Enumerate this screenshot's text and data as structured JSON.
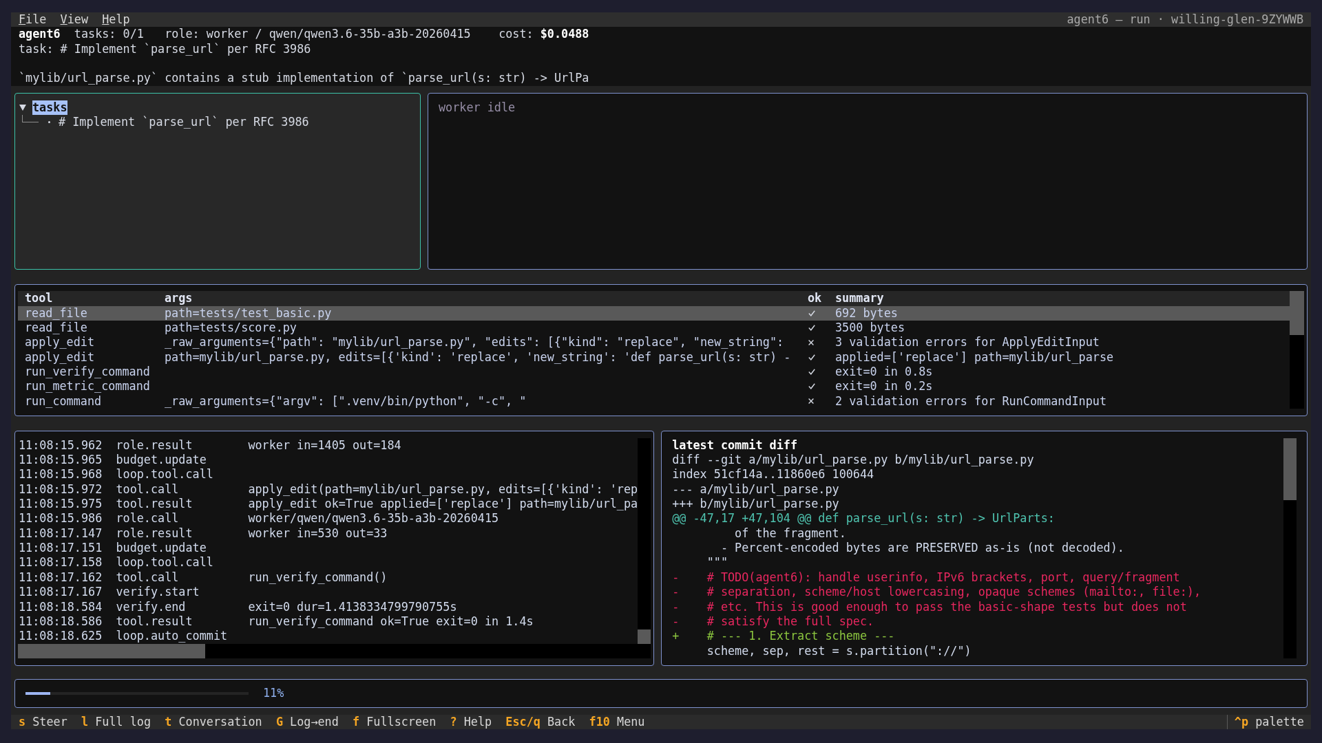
{
  "menu_bar": {
    "items": [
      {
        "label": "File"
      },
      {
        "label": "View"
      },
      {
        "label": "Help"
      }
    ],
    "title": "agent6 — run · willing-glen-9ZYWWB"
  },
  "header": {
    "app_name": "agent6",
    "tasks": "tasks: 0/1",
    "role": "role: worker / qwen/qwen3.6-35b-a3b-20260415",
    "cost": "cost: **$0.0488**",
    "task": "task: # Implement `parse_url` per RFC 3986",
    "description": "`mylib/url_parse.py` contains a stub implementation of `parse_url(s: str) -> UrlPa"
  },
  "task_tree": {
    "label": "tasks",
    "expanded": true,
    "selected": true,
    "children": [
      {
        "label": "# Implement `parse_url` per RFC 3986",
        "selected": false
      }
    ]
  },
  "worker_panel": {
    "status": "worker idle"
  },
  "tool_calls": {
    "columns": [
      "tool",
      "args",
      "ok",
      "summary"
    ],
    "rows": [
      {
        "tool": "read_file",
        "args": "path=tests/test_basic.py",
        "ok": true,
        "summary": "692 bytes",
        "selected": true
      },
      {
        "tool": "read_file",
        "args": "path=tests/score.py",
        "ok": true,
        "summary": "3500 bytes",
        "selected": false
      },
      {
        "tool": "apply_edit",
        "args": "_raw_arguments={\"path\": \"mylib/url_parse.py\", \"edits\": [{\"kind\": \"replace\", \"new_string\":",
        "ok": false,
        "summary": "3 validation errors for ApplyEditInput",
        "selected": false
      },
      {
        "tool": "apply_edit",
        "args": "path=mylib/url_parse.py, edits=[{'kind': 'replace', 'new_string': 'def parse_url(s: str) -",
        "ok": true,
        "summary": "applied=['replace'] path=mylib/url_parse",
        "selected": false
      },
      {
        "tool": "run_verify_command",
        "ok": true,
        "summary": "exit=0 in 0.8s",
        "selected": false
      },
      {
        "tool": "run_metric_command",
        "ok": true,
        "summary": "exit=0 in 0.2s",
        "selected": false
      },
      {
        "tool": "run_command",
        "args": "_raw_arguments={\"argv\": [\".venv/bin/python\", \"-c\", \"",
        "ok": false,
        "summary": "2 validation errors for RunCommandInput",
        "selected": false
      }
    ]
  },
  "event_log": {
    "rows": [
      {
        "time": "11:08:15.962",
        "event": "role.result",
        "detail": "worker in=1405 out=184"
      },
      {
        "time": "11:08:15.965",
        "event": "budget.update"
      },
      {
        "time": "11:08:15.968",
        "event": "loop.tool.call"
      },
      {
        "time": "11:08:15.972",
        "event": "tool.call",
        "detail": "apply_edit(path=mylib/url_parse.py, edits=[{'kind': 'rep"
      },
      {
        "time": "11:08:15.975",
        "event": "tool.result",
        "detail": "apply_edit ok=True applied=['replace'] path=mylib/url_pa"
      },
      {
        "time": "11:08:15.986",
        "event": "role.call",
        "detail": "worker/qwen/qwen3.6-35b-a3b-20260415"
      },
      {
        "time": "11:08:17.147",
        "event": "role.result",
        "detail": "worker in=530 out=33"
      },
      {
        "time": "11:08:17.151",
        "event": "budget.update"
      },
      {
        "time": "11:08:17.158",
        "event": "loop.tool.call"
      },
      {
        "time": "11:08:17.162",
        "event": "tool.call",
        "detail": "run_verify_command()"
      },
      {
        "time": "11:08:17.167",
        "event": "verify.start"
      },
      {
        "time": "11:08:18.584",
        "event": "verify.end",
        "detail": "exit=0 dur=1.4138334799790755s"
      },
      {
        "time": "11:08:18.586",
        "event": "tool.result",
        "detail": "run_verify_command ok=True exit=0 in 1.4s"
      },
      {
        "time": "11:08:18.625",
        "event": "loop.auto_commit"
      }
    ]
  },
  "diff_panel": {
    "title": "latest commit diff",
    "lines": [
      {
        "kind": "meta",
        "text": "diff --git a/mylib/url_parse.py b/mylib/url_parse.py"
      },
      {
        "kind": "meta",
        "text": "index 51cf14a..11860e6 100644"
      },
      {
        "kind": "meta",
        "text": "--- a/mylib/url_parse.py"
      },
      {
        "kind": "meta",
        "text": "+++ b/mylib/url_parse.py"
      },
      {
        "kind": "hunk",
        "text": "@@ -47,17 +47,104 @@ def parse_url(s: str) -> UrlParts:"
      },
      {
        "kind": "context",
        "text": "         of the fragment."
      },
      {
        "kind": "context",
        "text": "       - Percent-encoded bytes are PRESERVED as-is (not decoded)."
      },
      {
        "kind": "context",
        "text": "     \"\"\""
      },
      {
        "kind": "removed",
        "text": "-    # TODO(agent6): handle userinfo, IPv6 brackets, port, query/fragment"
      },
      {
        "kind": "removed",
        "text": "-    # separation, scheme/host lowercasing, opaque schemes (mailto:, file:),"
      },
      {
        "kind": "removed",
        "text": "-    # etc. This is good enough to pass the basic-shape tests but does not"
      },
      {
        "kind": "removed",
        "text": "-    # satisfy the full spec."
      },
      {
        "kind": "added",
        "text": "+    # --- 1. Extract scheme ---"
      },
      {
        "kind": "context",
        "text": "     scheme, sep, rest = s.partition(\"://\")"
      }
    ]
  },
  "progress": {
    "level": 0.11,
    "label": "11%"
  },
  "footer": {
    "shortcuts": [
      {
        "key": "s",
        "label": "Steer"
      },
      {
        "key": "l",
        "label": "Full log"
      },
      {
        "key": "t",
        "label": "Conversation"
      },
      {
        "key": "G",
        "label": "Log→end"
      },
      {
        "key": "f",
        "label": "Fullscreen"
      },
      {
        "key": "?",
        "label": "Help"
      },
      {
        "key": "Esc/q",
        "label": "Back"
      },
      {
        "key": "f10",
        "label": "Menu"
      }
    ],
    "palette": {
      "key": "^p",
      "label": "palette"
    }
  }
}
